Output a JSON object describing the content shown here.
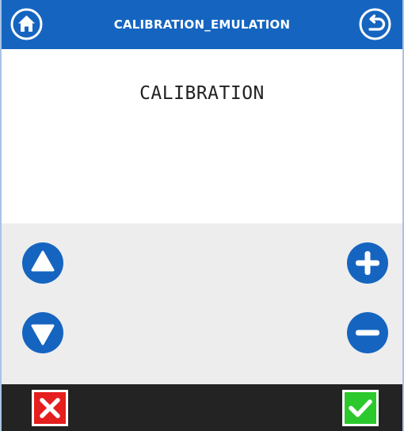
{
  "header": {
    "title": "CALIBRATION_EMULATION",
    "home_icon": "home-icon",
    "back_icon": "back-icon"
  },
  "main": {
    "label": "CALIBRATION"
  },
  "controls": {
    "up_icon": "triangle-up-icon",
    "down_icon": "triangle-down-icon",
    "plus_icon": "plus-icon",
    "minus_icon": "minus-icon"
  },
  "footer": {
    "cancel_icon": "x-icon",
    "confirm_icon": "check-icon"
  },
  "colors": {
    "header_bg": "#1565c0",
    "button_blue": "#1565c0",
    "controls_bg": "#ededed",
    "footer_bg": "#232323",
    "cancel_red": "#e51e1e",
    "confirm_green": "#2bc92b"
  }
}
